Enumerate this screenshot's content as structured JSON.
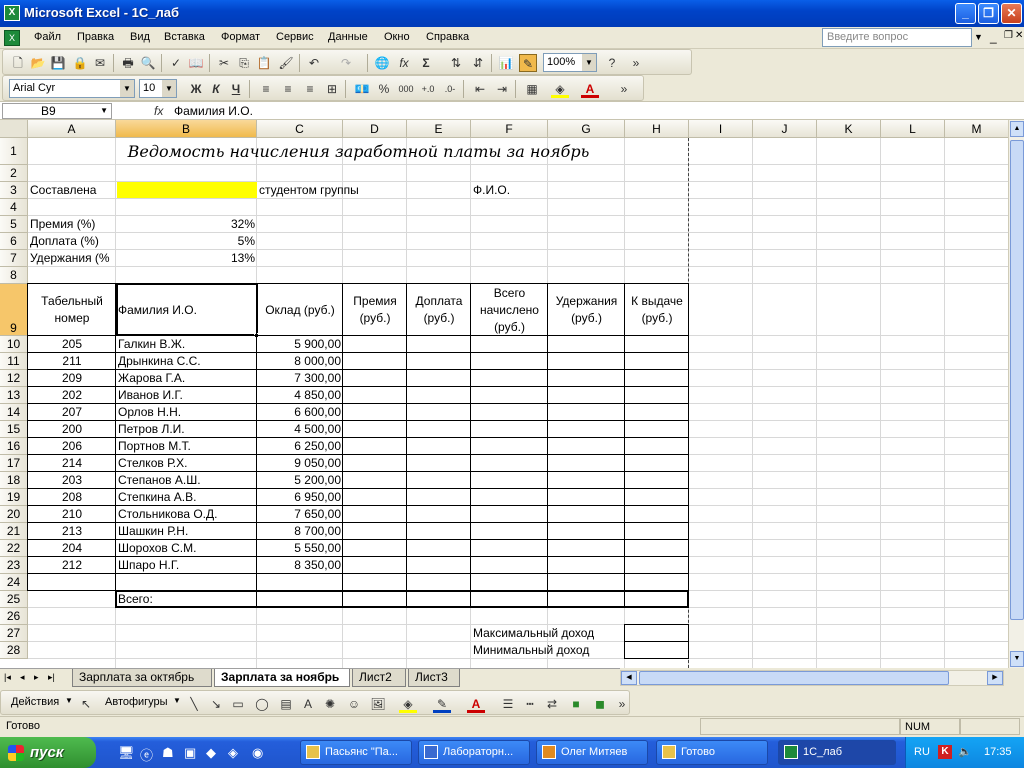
{
  "window": {
    "title": "Microsoft Excel - 1С_лаб"
  },
  "menu": {
    "items": [
      "Файл",
      "Правка",
      "Вид",
      "Вставка",
      "Формат",
      "Сервис",
      "Данные",
      "Окно",
      "Справка"
    ],
    "ask_placeholder": "Введите вопрос"
  },
  "toolbar": {
    "zoom": "100%",
    "font": "Arial Cyr",
    "size": "10",
    "bold": "Ж",
    "italic": "К",
    "underline": "Ч",
    "percent": "%",
    "thousands": "000"
  },
  "formula_bar": {
    "name_box": "B9",
    "fx": "fx",
    "formula": "Фамилия И.О."
  },
  "grid": {
    "columns": [
      "A",
      "B",
      "C",
      "D",
      "E",
      "F",
      "G",
      "H",
      "I",
      "J",
      "K",
      "L",
      "M"
    ],
    "rows": [
      "1",
      "2",
      "3",
      "4",
      "5",
      "6",
      "7",
      "8",
      "9",
      "10",
      "11",
      "12",
      "13",
      "14",
      "15",
      "16",
      "17",
      "18",
      "19",
      "20",
      "21",
      "22",
      "23",
      "24",
      "25",
      "26",
      "27",
      "28"
    ],
    "title": "Ведомость начисления заработной платы за ноябрь",
    "composed_label": "Составлена",
    "group_label": "студентом группы",
    "fio_label": "Ф.И.О.",
    "params": [
      {
        "label": "Премия (%)",
        "value": "32%"
      },
      {
        "label": "Доплата (%)",
        "value": "5%"
      },
      {
        "label": "Удержания (%",
        "value": "13%"
      }
    ],
    "headers": {
      "tab": [
        "Табельный",
        "номер"
      ],
      "name": "Фамилия И.О.",
      "salary": "Оклад (руб.)",
      "bonus": [
        "Премия",
        "(руб.)"
      ],
      "extra": [
        "Доплата",
        "(руб.)"
      ],
      "total": [
        "Всего",
        "начислено",
        "(руб.)"
      ],
      "deduct": [
        "Удержания",
        "(руб.)"
      ],
      "pay": [
        "К выдаче",
        "(руб.)"
      ]
    },
    "employees": [
      {
        "id": "205",
        "name": "Галкин В.Ж.",
        "salary": "5 900,00"
      },
      {
        "id": "211",
        "name": "Дрынкина С.С.",
        "salary": "8 000,00"
      },
      {
        "id": "209",
        "name": "Жарова Г.А.",
        "salary": "7 300,00"
      },
      {
        "id": "202",
        "name": "Иванов И.Г.",
        "salary": "4 850,00"
      },
      {
        "id": "207",
        "name": "Орлов Н.Н.",
        "salary": "6 600,00"
      },
      {
        "id": "200",
        "name": "Петров Л.И.",
        "salary": "4 500,00"
      },
      {
        "id": "206",
        "name": "Портнов М.Т.",
        "salary": "6 250,00"
      },
      {
        "id": "214",
        "name": "Стелков Р.Х.",
        "salary": "9 050,00"
      },
      {
        "id": "203",
        "name": "Степанов А.Ш.",
        "salary": "5 200,00"
      },
      {
        "id": "208",
        "name": "Степкина А.В.",
        "salary": "6 950,00"
      },
      {
        "id": "210",
        "name": "Стольникова О.Д.",
        "salary": "7 650,00"
      },
      {
        "id": "213",
        "name": "Шашкин Р.Н.",
        "salary": "8 700,00"
      },
      {
        "id": "204",
        "name": "Шорохов С.М.",
        "salary": "5 550,00"
      },
      {
        "id": "212",
        "name": "Шпаро Н.Г.",
        "salary": "8 350,00"
      }
    ],
    "total_label": "Всего:",
    "max_label": "Максимальный доход",
    "min_label": "Минимальный доход"
  },
  "sheets": [
    "Зарплата за октябрь",
    "Зарплата за ноябрь",
    "Лист2",
    "Лист3"
  ],
  "draw_toolbar": {
    "actions": "Действия",
    "autoshapes": "Автофигуры"
  },
  "status": {
    "ready": "Готово",
    "num": "NUM"
  },
  "taskbar": {
    "start": "пуск",
    "tasks": [
      "Пасьянс \"Па...",
      "Лабораторн...",
      "Олег Митяев",
      "Готово",
      "1С_лаб"
    ],
    "lang": "RU",
    "clock": "17:35"
  },
  "colors": {
    "selection": "#f6c66a",
    "highlight": "#ffff00",
    "title_bar": "#0a5fe8"
  }
}
